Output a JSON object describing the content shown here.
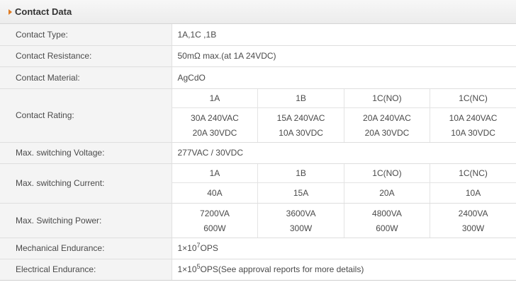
{
  "section_title": "Contact Data",
  "rows": {
    "contact_type": {
      "label": "Contact Type:",
      "value": "1A,1C ,1B"
    },
    "contact_resistance": {
      "label": "Contact Resistance:",
      "value": "50mΩ max.(at 1A 24VDC)"
    },
    "contact_material": {
      "label": "Contact Material:",
      "value": "AgCdO"
    },
    "contact_rating": {
      "label": "Contact Rating:",
      "headers": [
        "1A",
        "1B",
        "1C(NO)",
        "1C(NC)"
      ],
      "line1": [
        "30A 240VAC",
        "15A 240VAC",
        "20A 240VAC",
        "10A 240VAC"
      ],
      "line2": [
        "20A 30VDC",
        "10A 30VDC",
        "20A 30VDC",
        "10A 30VDC"
      ]
    },
    "max_switching_voltage": {
      "label": "Max. switching Voltage:",
      "value": "277VAC / 30VDC"
    },
    "max_switching_current": {
      "label": "Max. switching Current:",
      "headers": [
        "1A",
        "1B",
        "1C(NO)",
        "1C(NC)"
      ],
      "values": [
        "40A",
        "15A",
        "20A",
        "10A"
      ]
    },
    "max_switching_power": {
      "label": "Max. Switching Power:",
      "line1": [
        "7200VA",
        "3600VA",
        "4800VA",
        "2400VA"
      ],
      "line2": [
        "600W",
        "300W",
        "600W",
        "300W"
      ]
    },
    "mechanical_endurance": {
      "label": "Mechanical Endurance:",
      "prefix": "1×10",
      "exponent": "7",
      "suffix": "OPS"
    },
    "electrical_endurance": {
      "label": "Electrical Endurance:",
      "prefix": "1×10",
      "exponent": "5",
      "suffix": "OPS(See approval reports for more details)"
    }
  }
}
